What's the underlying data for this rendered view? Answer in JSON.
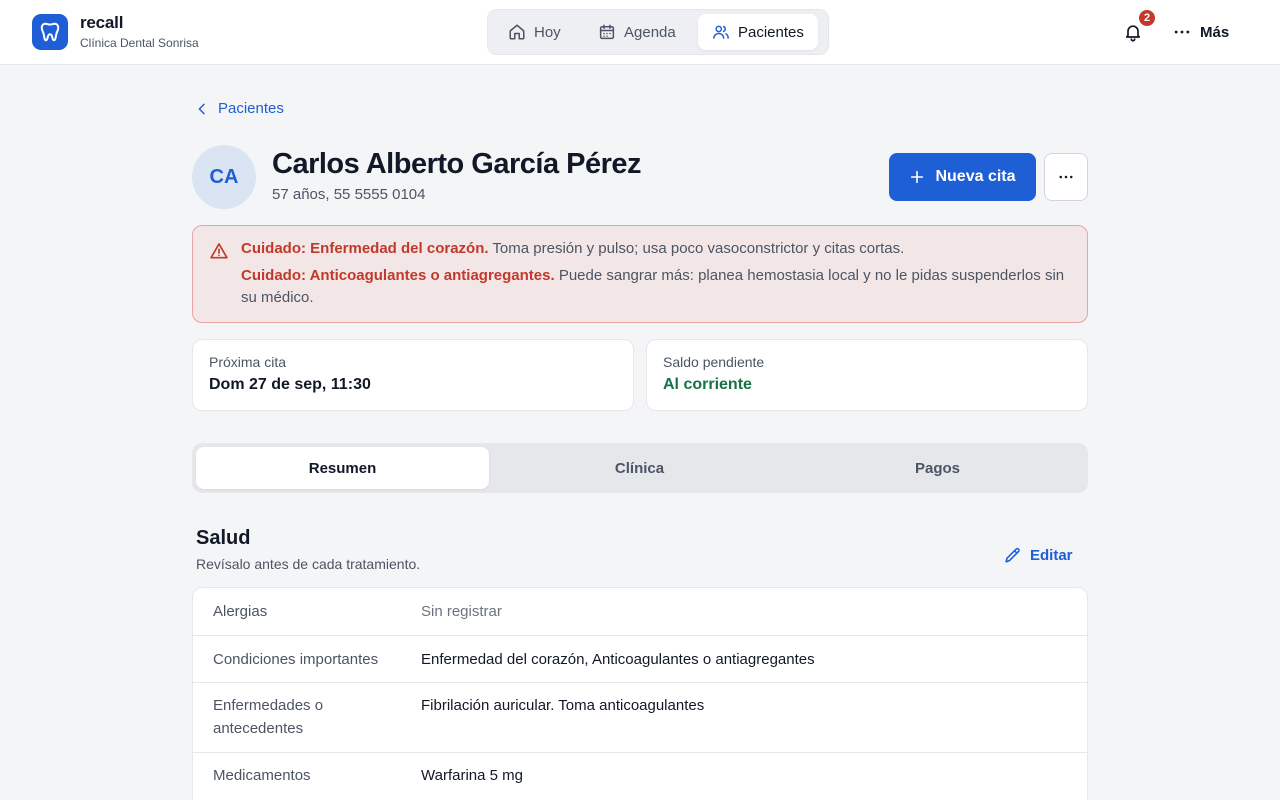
{
  "app": {
    "name": "recall",
    "clinic": "Clínica Dental Sonrisa",
    "brand_color": "#1f5fd6"
  },
  "nav": {
    "items": [
      {
        "label": "Hoy",
        "icon": "home-icon",
        "active": false
      },
      {
        "label": "Agenda",
        "icon": "calendar-icon",
        "active": false
      },
      {
        "label": "Pacientes",
        "icon": "users-icon",
        "active": true
      }
    ]
  },
  "header": {
    "notifications_count": "2",
    "more_label": "Más"
  },
  "breadcrumb": {
    "back_label": "Pacientes"
  },
  "patient": {
    "initials": "CA",
    "name": "Carlos Alberto García Pérez",
    "meta": "57 años, 55 5555 0104",
    "new_appointment_label": "Nueva cita"
  },
  "alerts": [
    {
      "title": "Cuidado: Enfermedad del corazón.",
      "text": " Toma presión y pulso; usa poco vasoconstrictor y citas cortas."
    },
    {
      "title": "Cuidado: Anticoagulantes o antiagregantes.",
      "text": " Puede sangrar más: planea hemostasia local y no le pidas suspenderlos sin su médico."
    }
  ],
  "cards": {
    "next_appointment": {
      "label": "Próxima cita",
      "value": "Dom 27 de sep, 11:30"
    },
    "balance": {
      "label": "Saldo pendiente",
      "value": "Al corriente",
      "value_color": "#177245"
    }
  },
  "tabs": [
    {
      "label": "Resumen",
      "active": true
    },
    {
      "label": "Clínica",
      "active": false
    },
    {
      "label": "Pagos",
      "active": false
    }
  ],
  "health": {
    "title": "Salud",
    "subtitle": "Revísalo antes de cada tratamiento.",
    "edit_label": "Editar",
    "rows": [
      {
        "label": "Alergias",
        "value": "Sin registrar",
        "empty": true
      },
      {
        "label": "Condiciones importantes",
        "value": "Enfermedad del corazón, Anticoagulantes o antiagregantes"
      },
      {
        "label": "Enfermedades o antecedentes",
        "value": "Fibrilación auricular. Toma anticoagulantes"
      },
      {
        "label": "Medicamentos",
        "value": "Warfarina 5 mg"
      }
    ]
  },
  "colors": {
    "alert_text": "#c0392b",
    "alert_bg": "#f3e6e7",
    "badge": "#c0392b"
  }
}
